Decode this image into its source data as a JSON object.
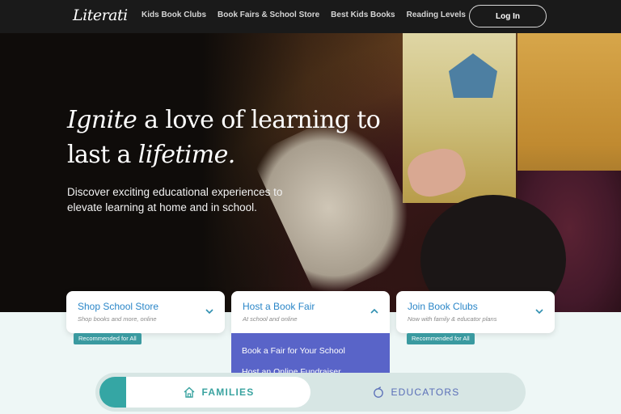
{
  "nav": {
    "logo": "Literati",
    "links": [
      "Kids Book Clubs",
      "Book Fairs & School Store",
      "Best Kids Books",
      "Reading Levels"
    ],
    "login_label": "Log In"
  },
  "hero": {
    "headline_em1": "Ignite",
    "headline_mid": " a love of learning to last a ",
    "headline_em2": "lifetime.",
    "subhead": "Discover exciting educational experiences to elevate learning at home and in school."
  },
  "cards": [
    {
      "title": "Shop School Store",
      "subtitle": "Shop books and more, online",
      "badge": "Recommended for All",
      "expanded": false
    },
    {
      "title": "Host a Book Fair",
      "subtitle": "At school and online",
      "badge": "",
      "expanded": true
    },
    {
      "title": "Join Book Clubs",
      "subtitle": "Now with family & educator plans",
      "badge": "Recommended for All",
      "expanded": false
    }
  ],
  "dropdown": {
    "items": [
      "Book a Fair for Your School",
      "Host an Online Fundraiser"
    ]
  },
  "toggle": {
    "families_label": "FAMILIES",
    "educators_label": "EDUCATORS",
    "selected": "FAMILIES"
  },
  "colors": {
    "nav_bg": "#1a1a1a",
    "card_title": "#2a86c8",
    "badge_bg": "#3a9aa0",
    "dropdown_bg": "#5964c8",
    "families_accent": "#35a6a4",
    "educators_text": "#5a6fb8"
  },
  "icons": {
    "card_chevron": "chevron-down-icon",
    "card_chevron_open": "chevron-up-icon",
    "families": "home-icon",
    "educators": "apple-icon"
  }
}
